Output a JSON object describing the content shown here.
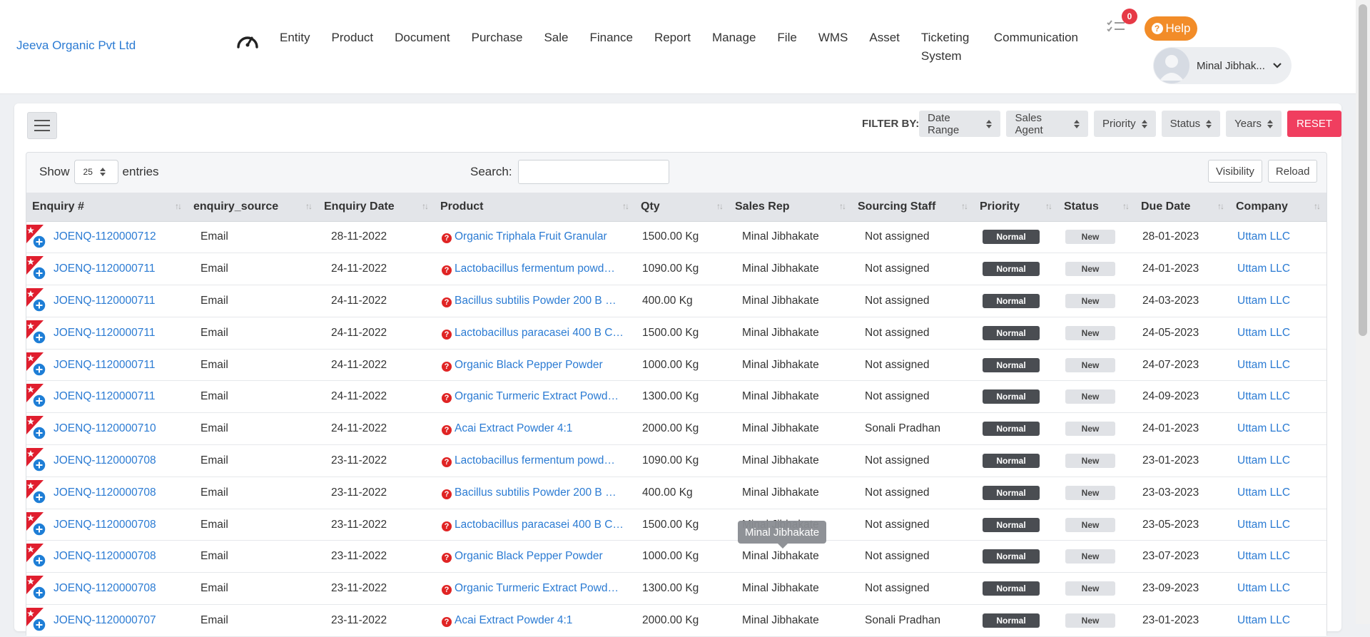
{
  "brand": "Jeeva Organic Pvt Ltd",
  "nav": {
    "items": [
      "Entity",
      "Product",
      "Document",
      "Purchase",
      "Sale",
      "Finance",
      "Report",
      "Manage",
      "File",
      "WMS",
      "Asset",
      "Ticketing System",
      "Communication"
    ]
  },
  "notifications": {
    "count": "0"
  },
  "help_label": "Help",
  "user": {
    "name": "Minal Jibhak..."
  },
  "filter": {
    "label": "FILTER BY:",
    "buttons": [
      "Date Range",
      "Sales Agent",
      "Priority",
      "Status",
      "Years"
    ],
    "reset_label": "RESET"
  },
  "table_controls": {
    "show_label": "Show",
    "entries_value": "25",
    "entries_label": "entries",
    "search_label": "Search:",
    "search_value": "",
    "visibility_label": "Visibility",
    "reload_label": "Reload"
  },
  "columns": [
    "Enquiry #",
    "enquiry_source",
    "Enquiry Date",
    "Product",
    "Qty",
    "Sales Rep",
    "Sourcing Staff",
    "Priority",
    "Status",
    "Due Date",
    "Company"
  ],
  "rows": [
    {
      "enquiry": "JOENQ-1120000712",
      "source": "Email",
      "date": "28-11-2022",
      "product": "Organic Triphala Fruit Granular",
      "qty": "1500.00 Kg",
      "rep": "Minal Jibhakate",
      "staff": "Not assigned",
      "priority": "Normal",
      "status": "New",
      "due": "28-01-2023",
      "company": "Uttam LLC"
    },
    {
      "enquiry": "JOENQ-1120000711",
      "source": "Email",
      "date": "24-11-2022",
      "product": "Lactobacillus fermentum powd…",
      "qty": "1090.00 Kg",
      "rep": "Minal Jibhakate",
      "staff": "Not assigned",
      "priority": "Normal",
      "status": "New",
      "due": "24-01-2023",
      "company": "Uttam LLC"
    },
    {
      "enquiry": "JOENQ-1120000711",
      "source": "Email",
      "date": "24-11-2022",
      "product": "Bacillus subtilis Powder 200 B …",
      "qty": "400.00 Kg",
      "rep": "Minal Jibhakate",
      "staff": "Not assigned",
      "priority": "Normal",
      "status": "New",
      "due": "24-03-2023",
      "company": "Uttam LLC"
    },
    {
      "enquiry": "JOENQ-1120000711",
      "source": "Email",
      "date": "24-11-2022",
      "product": "Lactobacillus paracasei 400 B C…",
      "qty": "1500.00 Kg",
      "rep": "Minal Jibhakate",
      "staff": "Not assigned",
      "priority": "Normal",
      "status": "New",
      "due": "24-05-2023",
      "company": "Uttam LLC"
    },
    {
      "enquiry": "JOENQ-1120000711",
      "source": "Email",
      "date": "24-11-2022",
      "product": "Organic Black Pepper Powder",
      "qty": "1000.00 Kg",
      "rep": "Minal Jibhakate",
      "staff": "Not assigned",
      "priority": "Normal",
      "status": "New",
      "due": "24-07-2023",
      "company": "Uttam LLC"
    },
    {
      "enquiry": "JOENQ-1120000711",
      "source": "Email",
      "date": "24-11-2022",
      "product": "Organic Turmeric Extract Powd…",
      "qty": "1300.00 Kg",
      "rep": "Minal Jibhakate",
      "staff": "Not assigned",
      "priority": "Normal",
      "status": "New",
      "due": "24-09-2023",
      "company": "Uttam LLC"
    },
    {
      "enquiry": "JOENQ-1120000710",
      "source": "Email",
      "date": "24-11-2022",
      "product": "Acai Extract Powder 4:1",
      "qty": "2000.00 Kg",
      "rep": "Minal Jibhakate",
      "staff": "Sonali Pradhan",
      "priority": "Normal",
      "status": "New",
      "due": "24-01-2023",
      "company": "Uttam LLC"
    },
    {
      "enquiry": "JOENQ-1120000708",
      "source": "Email",
      "date": "23-11-2022",
      "product": "Lactobacillus fermentum powd…",
      "qty": "1090.00 Kg",
      "rep": "Minal Jibhakate",
      "staff": "Not assigned",
      "priority": "Normal",
      "status": "New",
      "due": "23-01-2023",
      "company": "Uttam LLC"
    },
    {
      "enquiry": "JOENQ-1120000708",
      "source": "Email",
      "date": "23-11-2022",
      "product": "Bacillus subtilis Powder 200 B …",
      "qty": "400.00 Kg",
      "rep": "Minal Jibhakate",
      "staff": "Not assigned",
      "priority": "Normal",
      "status": "New",
      "due": "23-03-2023",
      "company": "Uttam LLC"
    },
    {
      "enquiry": "JOENQ-1120000708",
      "source": "Email",
      "date": "23-11-2022",
      "product": "Lactobacillus paracasei 400 B C…",
      "qty": "1500.00 Kg",
      "rep": "Minal Jibhakate",
      "staff": "Not assigned",
      "priority": "Normal",
      "status": "New",
      "due": "23-05-2023",
      "company": "Uttam LLC"
    },
    {
      "enquiry": "JOENQ-1120000708",
      "source": "Email",
      "date": "23-11-2022",
      "product": "Organic Black Pepper Powder",
      "qty": "1000.00 Kg",
      "rep": "Minal Jibhakate",
      "staff": "Not assigned",
      "priority": "Normal",
      "status": "New",
      "due": "23-07-2023",
      "company": "Uttam LLC"
    },
    {
      "enquiry": "JOENQ-1120000708",
      "source": "Email",
      "date": "23-11-2022",
      "product": "Organic Turmeric Extract Powd…",
      "qty": "1300.00 Kg",
      "rep": "Minal Jibhakate",
      "staff": "Not assigned",
      "priority": "Normal",
      "status": "New",
      "due": "23-09-2023",
      "company": "Uttam LLC"
    },
    {
      "enquiry": "JOENQ-1120000707",
      "source": "Email",
      "date": "23-11-2022",
      "product": "Acai Extract Powder 4:1",
      "qty": "2000.00 Kg",
      "rep": "Minal Jibhakate",
      "staff": "Sonali Pradhan",
      "priority": "Normal",
      "status": "New",
      "due": "23-01-2023",
      "company": "Uttam LLC"
    }
  ],
  "tooltip": "Minal Jibhakate",
  "colors": {
    "link": "#2b7bd3",
    "help": "#f28c28",
    "reset": "#f03e5f",
    "badge": "#e63946",
    "priority_pill": "#4a4d52"
  }
}
